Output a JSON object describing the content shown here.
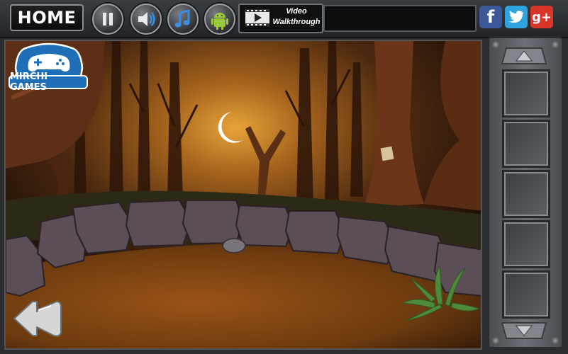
{
  "toolbar": {
    "home_label": "HOME",
    "video_line1": "Video",
    "video_line2": "Walkthrough",
    "social": {
      "facebook": "f",
      "twitter": "t",
      "google_plus": "g+"
    }
  },
  "logo": {
    "brand": "MIRCHI GAMES"
  },
  "inventory": {
    "slot_count": 5
  },
  "colors": {
    "facebook": "#3b5998",
    "twitter": "#2ea3dd",
    "google_plus": "#d8342a",
    "android": "#9bc93c",
    "moon_glow": "#e19a2a",
    "ground": "#8a4a14"
  }
}
